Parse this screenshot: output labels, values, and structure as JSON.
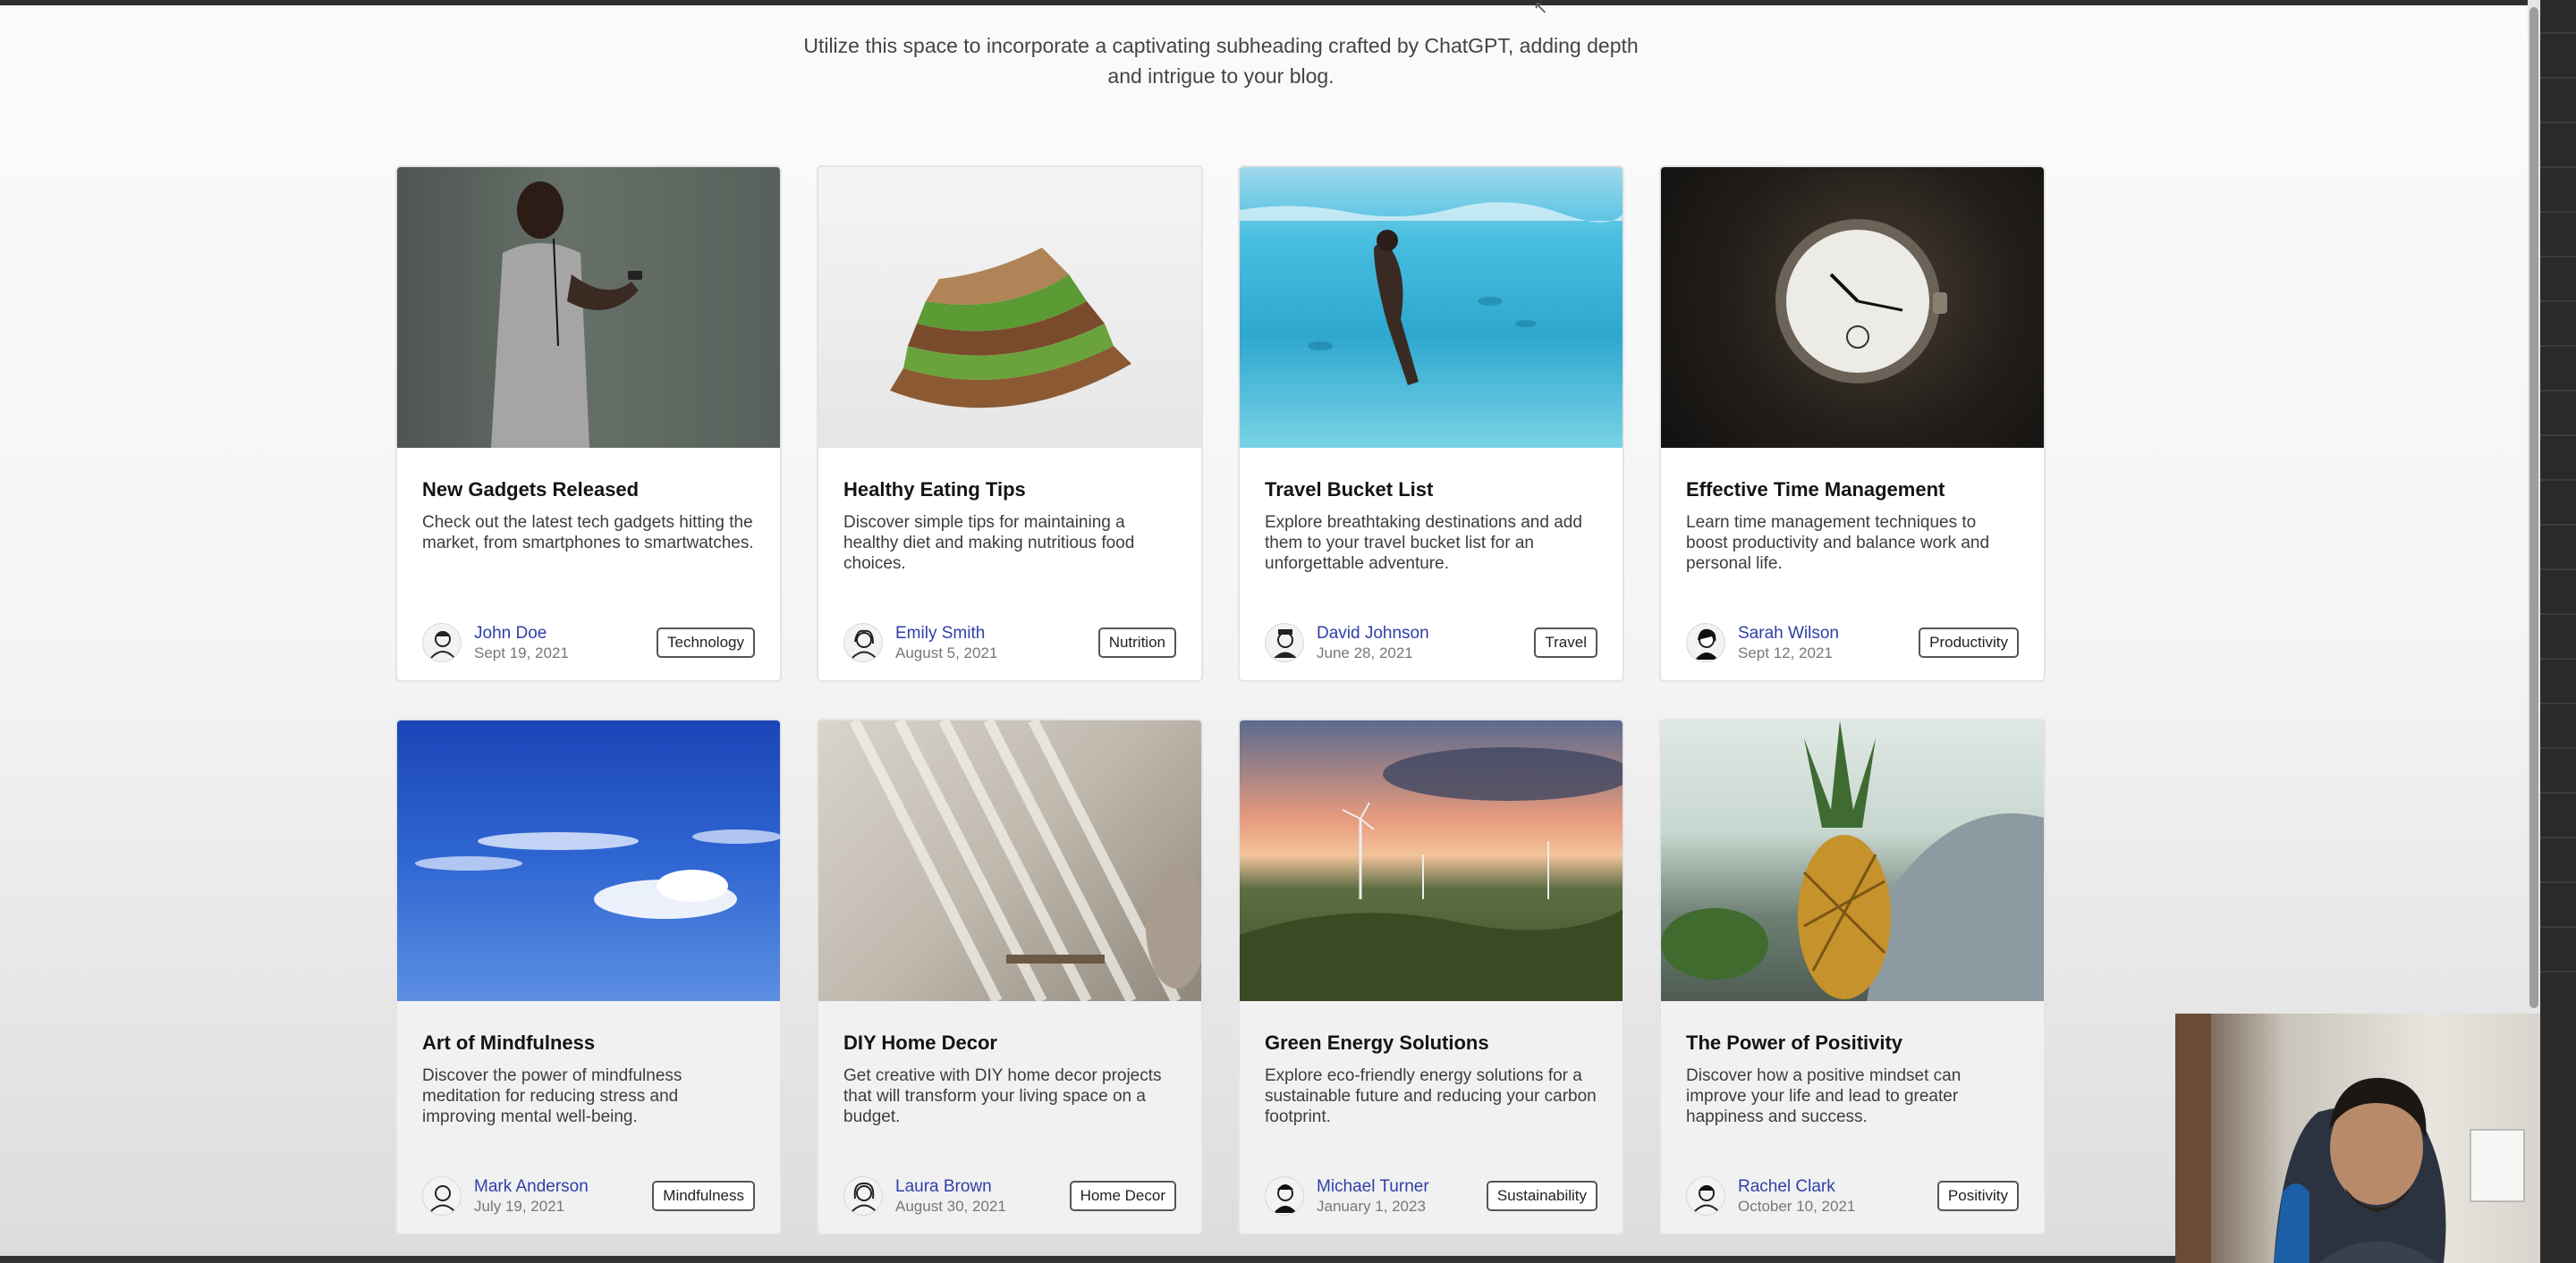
{
  "page": {
    "subheading": "Utilize this space to incorporate a captivating subheading crafted by ChatGPT, adding depth and intrigue to your blog."
  },
  "posts": [
    {
      "title": "New Gadgets Released",
      "description": "Check out the latest tech gadgets hitting the market, from smartphones to smartwatches.",
      "author": "John Doe",
      "date": "Sept 19, 2021",
      "tag": "Technology",
      "image": "man-using-smartphone"
    },
    {
      "title": "Healthy Eating Tips",
      "description": "Discover simple tips for maintaining a healthy diet and making nutritious food choices.",
      "author": "Emily Smith",
      "date": "August 5, 2021",
      "tag": "Nutrition",
      "image": "sandwich"
    },
    {
      "title": "Travel Bucket List",
      "description": "Explore breathtaking destinations and add them to your travel bucket list for an unforgettable adventure.",
      "author": "David Johnson",
      "date": "June 28, 2021",
      "tag": "Travel",
      "image": "swimmer-underwater"
    },
    {
      "title": "Effective Time Management",
      "description": "Learn time management techniques to boost productivity and balance work and personal life.",
      "author": "Sarah Wilson",
      "date": "Sept 12, 2021",
      "tag": "Productivity",
      "image": "pocket-watch"
    },
    {
      "title": "Art of Mindfulness",
      "description": "Discover the power of mindfulness meditation for reducing stress and improving mental well-being.",
      "author": "Mark Anderson",
      "date": "July 19, 2021",
      "tag": "Mindfulness",
      "image": "clouds-sky"
    },
    {
      "title": "DIY Home Decor",
      "description": "Get creative with DIY home decor projects that will transform your living space on a budget.",
      "author": "Laura Brown",
      "date": "August 30, 2021",
      "tag": "Home Decor",
      "image": "light-shadows-room"
    },
    {
      "title": "Green Energy Solutions",
      "description": "Explore eco-friendly energy solutions for a sustainable future and reducing your carbon footprint.",
      "author": "Michael Turner",
      "date": "January 1, 2023",
      "tag": "Sustainability",
      "image": "wind-turbines-sunset"
    },
    {
      "title": "The Power of Positivity",
      "description": "Discover how a positive mindset can improve your life and lead to greater happiness and success.",
      "author": "Rachel Clark",
      "date": "October 10, 2021",
      "tag": "Positivity",
      "image": "pineapple-on-rock"
    }
  ],
  "colors": {
    "author_link": "#2f3fa8",
    "tag_border": "#555555"
  }
}
